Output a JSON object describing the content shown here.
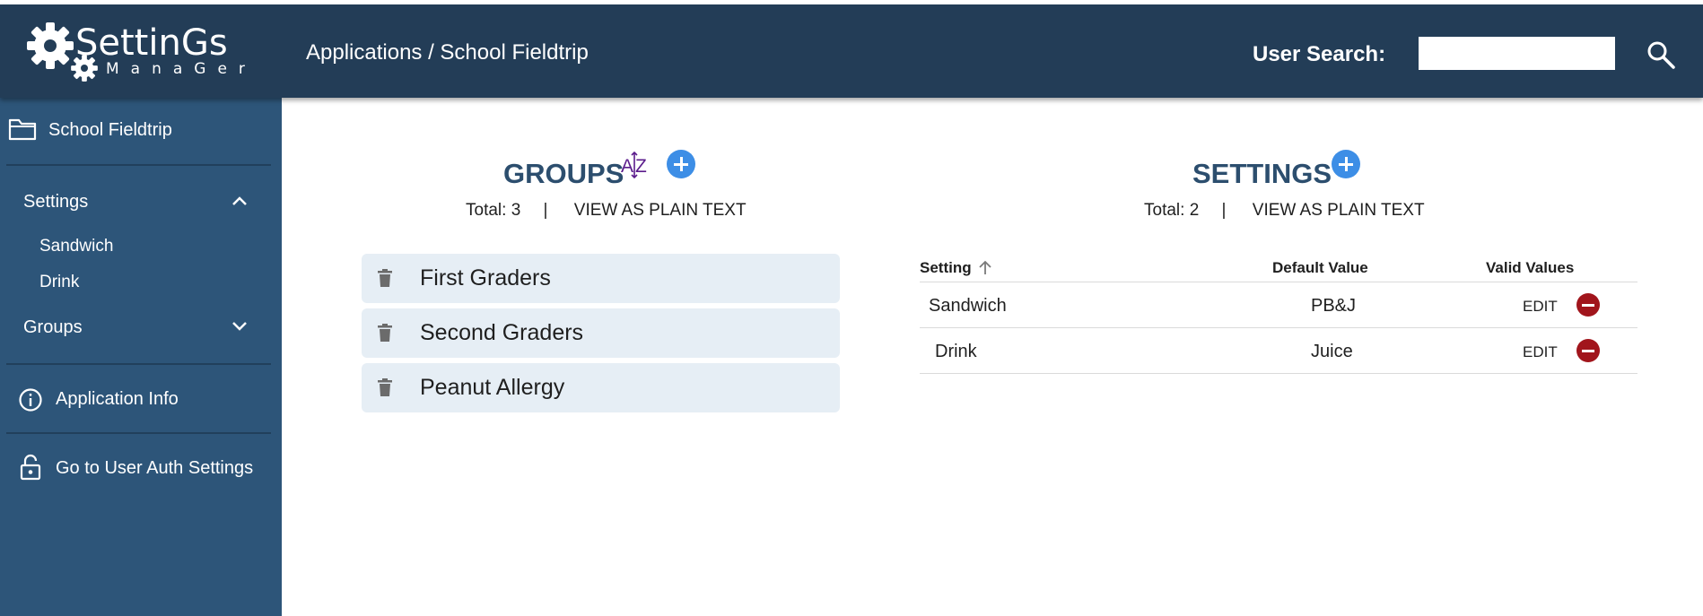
{
  "header": {
    "logo_main": "SettinGs",
    "logo_sub": "ManaGer",
    "breadcrumb": "Applications / School Fieldtrip",
    "search_label": "User Search:",
    "search_value": ""
  },
  "sidebar": {
    "app_name": "School Fieldtrip",
    "settings_label": "Settings",
    "settings_items": [
      "Sandwich",
      "Drink"
    ],
    "groups_label": "Groups",
    "app_info_label": "Application Info",
    "auth_label": "Go to User Auth Settings"
  },
  "groups_panel": {
    "title": "GROUPS",
    "sort_icon": "az-sort-icon",
    "total_label": "Total: 3",
    "separator": "|",
    "plain_text_link": "VIEW AS PLAIN TEXT",
    "items": [
      "First Graders",
      "Second Graders",
      "Peanut Allergy"
    ]
  },
  "settings_panel": {
    "title": "SETTINGS",
    "total_label": "Total: 2",
    "separator": "|",
    "plain_text_link": "VIEW AS PLAIN TEXT",
    "columns": {
      "setting": "Setting",
      "default_value": "Default Value",
      "valid_values": "Valid Values"
    },
    "rows": [
      {
        "setting": "Sandwich",
        "default_value": "PB&J",
        "edit": "EDIT"
      },
      {
        "setting": "Drink",
        "default_value": "Juice",
        "edit": "EDIT"
      }
    ]
  },
  "colors": {
    "header_bg": "#233d57",
    "sidebar_bg": "#2d5579",
    "title": "#2c4e6e",
    "add_button": "#3d8ee6",
    "remove_button": "#a1151c",
    "sort_icon": "#5b1c8c",
    "group_card_bg": "#e6eef5"
  }
}
